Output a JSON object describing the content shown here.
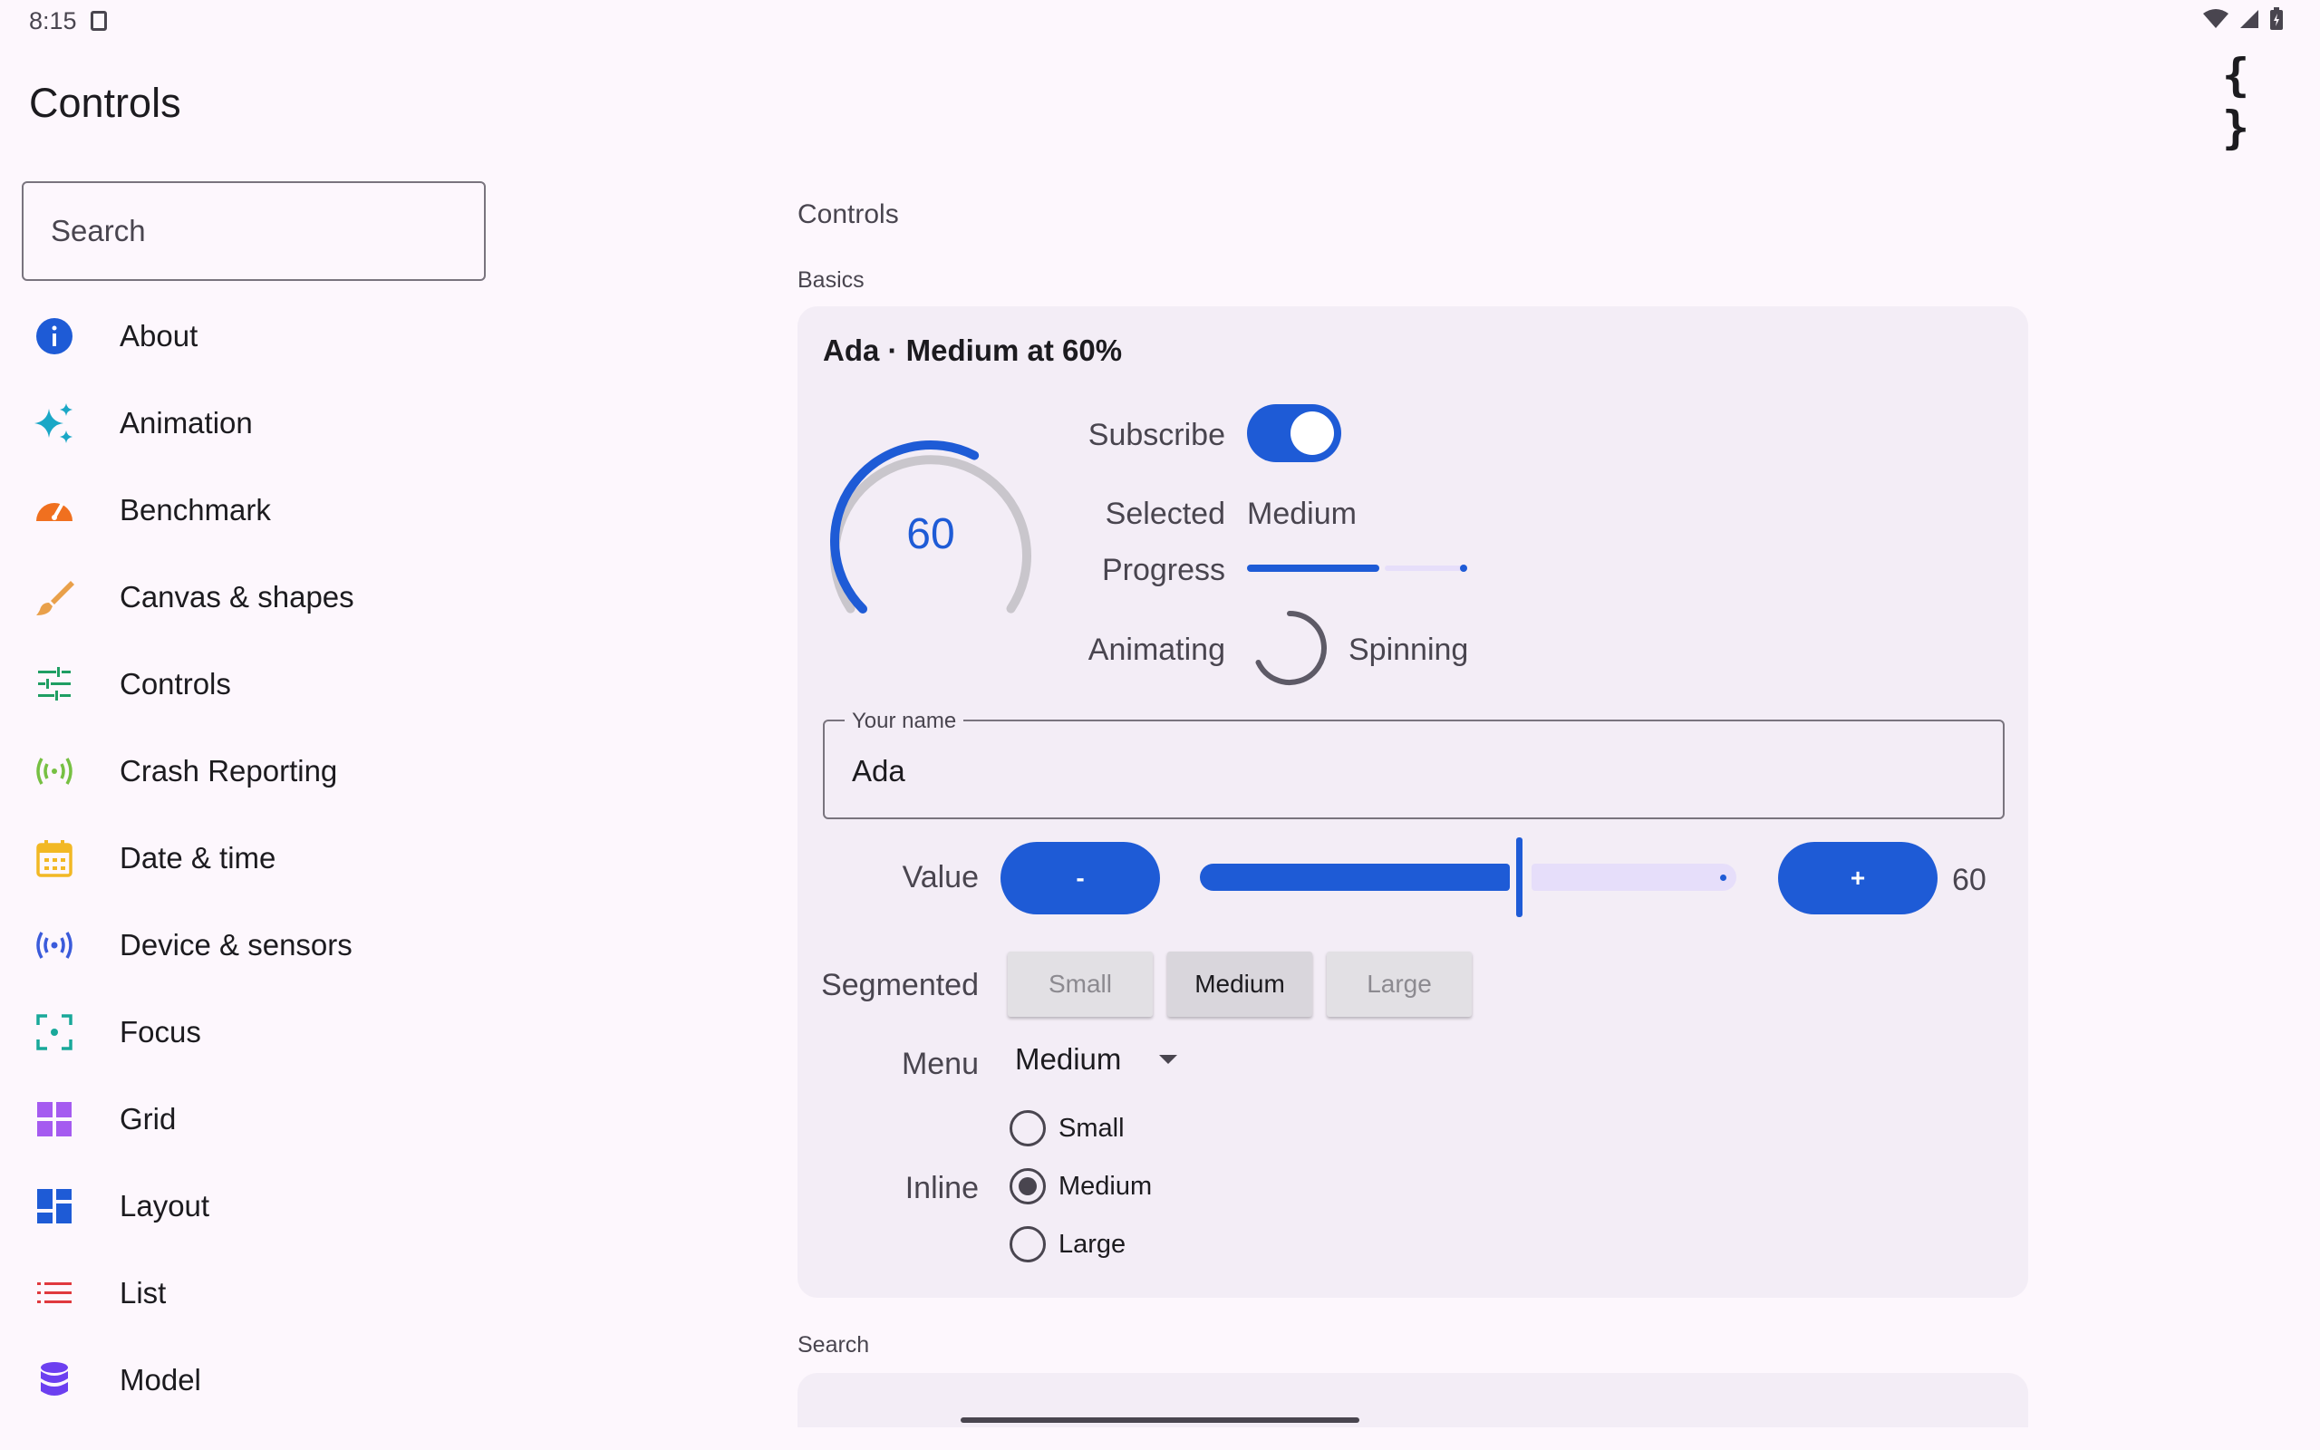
{
  "status_bar": {
    "time": "8:15"
  },
  "app_bar": {
    "title": "Controls",
    "code_icon": "{ }"
  },
  "sidebar": {
    "search_placeholder": "Search",
    "items": [
      {
        "label": "About",
        "icon": "info-icon",
        "color": "#1e5bd6"
      },
      {
        "label": "Animation",
        "icon": "sparkle-icon",
        "color": "#1aa7c6"
      },
      {
        "label": "Benchmark",
        "icon": "speedometer-icon",
        "color": "#f0701f"
      },
      {
        "label": "Canvas & shapes",
        "icon": "brush-icon",
        "color": "#e9a04a"
      },
      {
        "label": "Controls",
        "icon": "tune-icon",
        "color": "#1f9e63"
      },
      {
        "label": "Crash Reporting",
        "icon": "broadcast-icon",
        "color": "#77c043"
      },
      {
        "label": "Date & time",
        "icon": "calendar-icon",
        "color": "#f2b824"
      },
      {
        "label": "Device & sensors",
        "icon": "sensors-icon",
        "color": "#3b5bdb"
      },
      {
        "label": "Focus",
        "icon": "focus-icon",
        "color": "#19a89a"
      },
      {
        "label": "Grid",
        "icon": "grid-icon",
        "color": "#a55bf0"
      },
      {
        "label": "Layout",
        "icon": "dashboard-icon",
        "color": "#1e5bd6"
      },
      {
        "label": "List",
        "icon": "list-icon",
        "color": "#e0393e"
      },
      {
        "label": "Model",
        "icon": "database-icon",
        "color": "#6c3ff0"
      }
    ]
  },
  "main": {
    "section_title": "Controls",
    "basics_label": "Basics",
    "card_title": "Ada · Medium at 60%",
    "gauge_value": "60",
    "gauge_fraction": 0.6,
    "subscribe_label": "Subscribe",
    "subscribe_on": true,
    "selected_label": "Selected",
    "selected_value": "Medium",
    "progress_label": "Progress",
    "progress_fraction": 0.6,
    "animating_label": "Animating",
    "animating_value": "Spinning",
    "name_field_label": "Your name",
    "name_field_value": "Ada",
    "value_label": "Value",
    "minus_label": "-",
    "plus_label": "+",
    "value_number": "60",
    "slider_fraction": 0.6,
    "segmented_label": "Segmented",
    "segments": [
      "Small",
      "Medium",
      "Large"
    ],
    "segment_selected": "Medium",
    "menu_label": "Menu",
    "menu_value": "Medium",
    "inline_label": "Inline",
    "radio_options": [
      "Small",
      "Medium",
      "Large"
    ],
    "radio_selected": "Medium",
    "search_section_label": "Search"
  },
  "colors": {
    "accent": "#1e5bd6",
    "background": "#fdf7fd",
    "card": "#f3edf6"
  }
}
